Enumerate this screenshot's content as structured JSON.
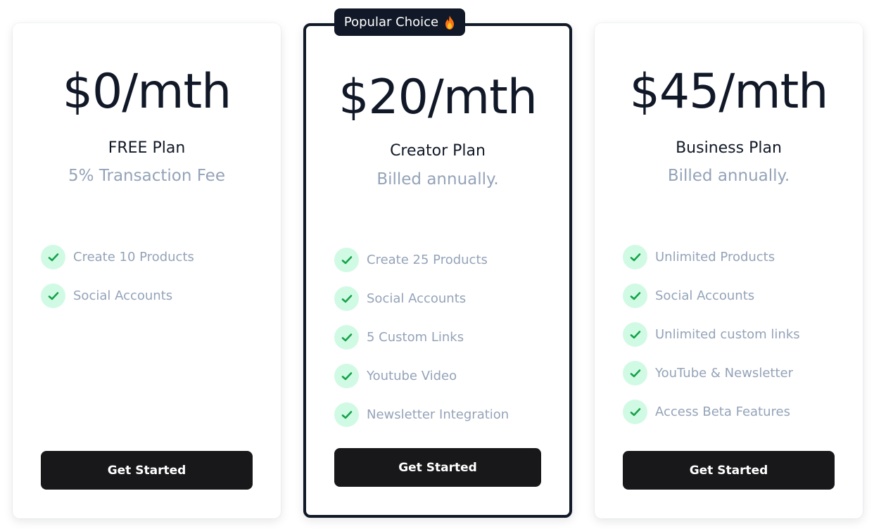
{
  "badge": {
    "label": "Popular Choice",
    "icon": "fire-icon"
  },
  "colors": {
    "dark": "#111827",
    "button": "#18181b",
    "muted_text": "#94a3b8",
    "check_bg": "#d1fae5",
    "check_mark": "#16a34a"
  },
  "plans": [
    {
      "price": "$0/mth",
      "name": "FREE Plan",
      "subtitle": "5% Transaction Fee",
      "features": [
        "Create 10 Products",
        "Social Accounts"
      ],
      "cta": "Get Started",
      "highlighted": false
    },
    {
      "price": "$20/mth",
      "name": "Creator Plan",
      "subtitle": "Billed annually.",
      "features": [
        "Create 25 Products",
        "Social Accounts",
        "5 Custom Links",
        "Youtube Video",
        "Newsletter Integration"
      ],
      "cta": "Get Started",
      "highlighted": true
    },
    {
      "price": "$45/mth",
      "name": "Business Plan",
      "subtitle": "Billed annually.",
      "features": [
        "Unlimited Products",
        "Social Accounts",
        "Unlimited custom links",
        "YouTube & Newsletter",
        "Access Beta Features"
      ],
      "cta": "Get Started",
      "highlighted": false
    }
  ]
}
